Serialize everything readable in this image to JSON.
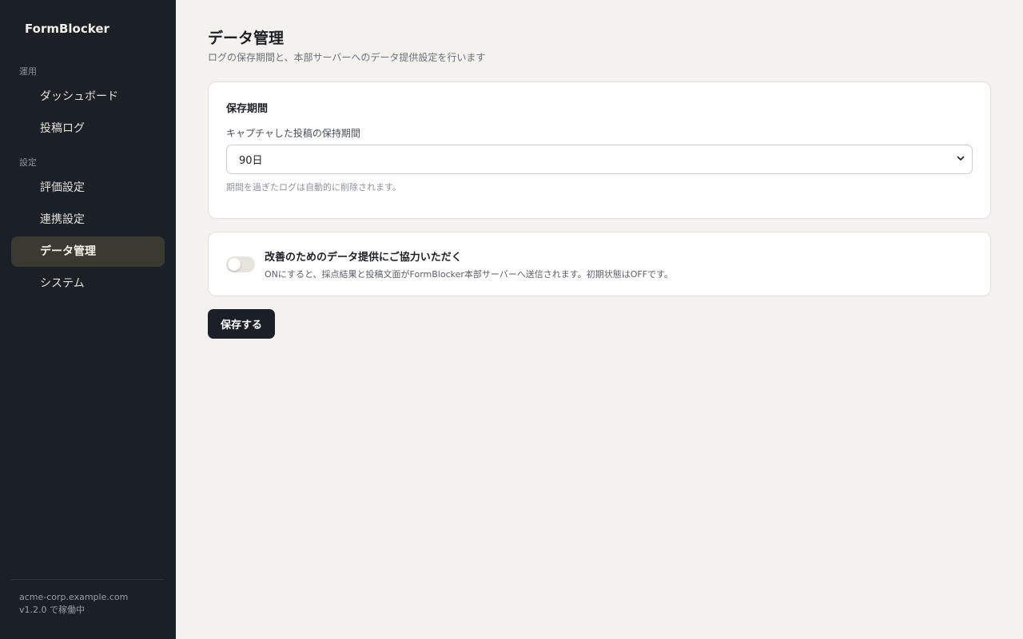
{
  "app": {
    "brand": "FormBlocker"
  },
  "sidebar": {
    "groups": [
      {
        "label": "運用",
        "items": [
          {
            "label": "ダッシュボード"
          },
          {
            "label": "投稿ログ"
          }
        ]
      },
      {
        "label": "設定",
        "items": [
          {
            "label": "評価設定"
          },
          {
            "label": "連携設定"
          },
          {
            "label": "データ管理",
            "active": true
          },
          {
            "label": "システム"
          }
        ]
      }
    ],
    "footer": {
      "host": "acme-corp.example.com",
      "version_status": "v1.2.0 で稼働中"
    }
  },
  "page": {
    "title": "データ管理",
    "subtitle": "ログの保存期間と、本部サーバーへのデータ提供設定を行います"
  },
  "retention": {
    "section_title": "保存期間",
    "field_label": "キャプチャした投稿の保持期間",
    "selected_value": "90日",
    "help_text": "期間を過ぎたログは自動的に削除されます。"
  },
  "consent": {
    "title": "改善のためのデータ提供にご協力いただく",
    "description": "ONにすると、採点結果と投稿文面がFormBlocker本部サーバーへ送信されます。初期状態はOFFです。",
    "enabled": false
  },
  "actions": {
    "save_label": "保存する"
  },
  "colors": {
    "sidebar_bg": "#1b1f26",
    "active_item_bg": "#3a3a33",
    "page_bg": "#f3f2ee",
    "primary_button": "#1b1f26"
  }
}
